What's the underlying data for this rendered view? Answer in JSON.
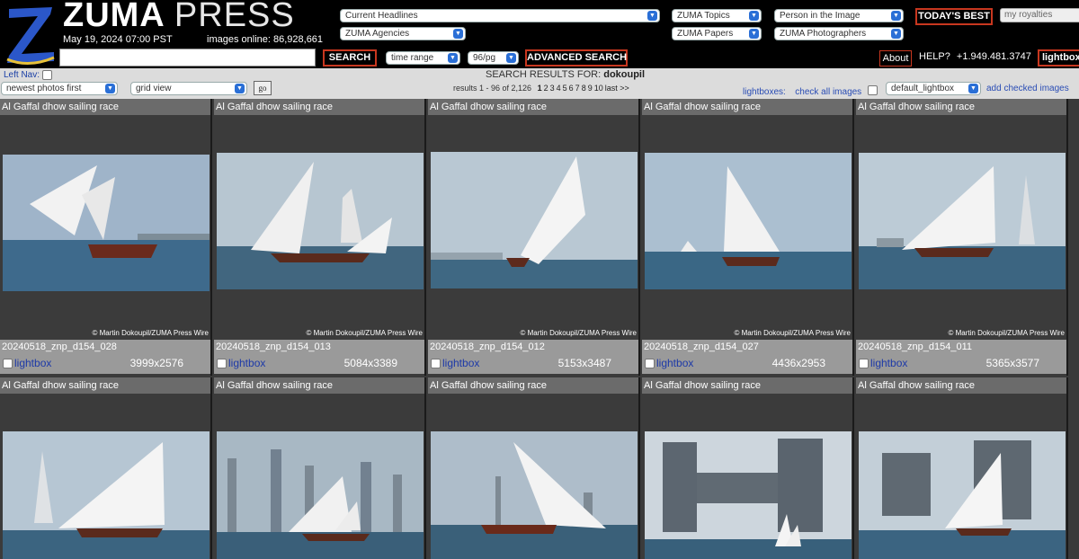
{
  "header": {
    "brand_zuma": "ZUMA",
    "brand_press": "PRESS",
    "date": "May 19, 2024 07:00 PST",
    "images_online": "images online: 86,928,661",
    "search_value": "",
    "search_button": "SEARCH",
    "time_range": "time range",
    "per_page": "96/pg",
    "advanced_search": "ADVANCED SEARCH",
    "current_headlines": "Current Headlines",
    "zuma_agencies": "ZUMA Agencies",
    "zuma_topics": "ZUMA Topics",
    "zuma_papers": "ZUMA Papers",
    "person_in_image": "Person in the Image",
    "zuma_photographers": "ZUMA Photographers",
    "todays_best": "TODAY'S BEST",
    "my_royalties": "my royalties",
    "about": "About",
    "help": "HELP?",
    "phone": "+1.949.481.3747",
    "lightbox": "lightbox"
  },
  "controls": {
    "left_nav": "Left Nav:",
    "sort": "newest photos first",
    "view": "grid view",
    "go": "go",
    "results_label": "SEARCH RESULTS FOR:",
    "query": "dokoupil",
    "results_range": "results 1 - 96 of 2,126",
    "pages": [
      "1",
      "2",
      "3",
      "4",
      "5",
      "6",
      "7",
      "8",
      "9",
      "10"
    ],
    "last": "last >>",
    "lightboxes_label": "lightboxes:",
    "check_all": "check all images",
    "lightbox_select": "default_lightbox",
    "add_checked": "add checked images"
  },
  "results": [
    {
      "title": "Al Gaffal dhow sailing race",
      "credit": "© Martin Dokoupil/ZUMA Press Wire",
      "file": "20240518_znp_d154_028",
      "lightbox": "lightbox",
      "dims": "3999x2576"
    },
    {
      "title": "Al Gaffal dhow sailing race",
      "credit": "© Martin Dokoupil/ZUMA Press Wire",
      "file": "20240518_znp_d154_013",
      "lightbox": "lightbox",
      "dims": "5084x3389"
    },
    {
      "title": "Al Gaffal dhow sailing race",
      "credit": "© Martin Dokoupil/ZUMA Press Wire",
      "file": "20240518_znp_d154_012",
      "lightbox": "lightbox",
      "dims": "5153x3487"
    },
    {
      "title": "Al Gaffal dhow sailing race",
      "credit": "© Martin Dokoupil/ZUMA Press Wire",
      "file": "20240518_znp_d154_027",
      "lightbox": "lightbox",
      "dims": "4436x2953"
    },
    {
      "title": "Al Gaffal dhow sailing race",
      "credit": "© Martin Dokoupil/ZUMA Press Wire",
      "file": "20240518_znp_d154_011",
      "lightbox": "lightbox",
      "dims": "5365x3577"
    },
    {
      "title": "Al Gaffal dhow sailing race"
    },
    {
      "title": "Al Gaffal dhow sailing race"
    },
    {
      "title": "Al Gaffal dhow sailing race"
    },
    {
      "title": "Al Gaffal dhow sailing race"
    },
    {
      "title": "Al Gaffal dhow sailing race"
    }
  ]
}
